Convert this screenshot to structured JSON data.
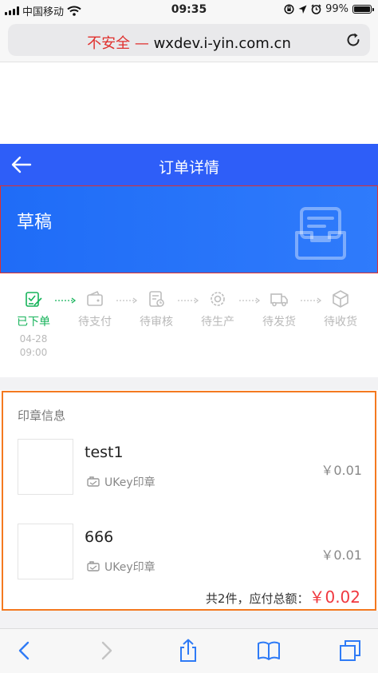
{
  "status_bar": {
    "carrier": "中国移动",
    "time": "09:35",
    "battery_percent": "99%",
    "battery_level": 0.99,
    "icons": [
      "signal-icon",
      "wifi-icon",
      "orientation-lock-icon",
      "location-icon",
      "alarm-icon",
      "battery-icon"
    ]
  },
  "browser": {
    "warning": "不安全 —",
    "host": "wxdev.i-yin.com.cn",
    "reload_icon": "reload-icon",
    "warning_color": "#e0302d"
  },
  "header": {
    "title": "订单详情",
    "back_icon": "back-arrow-icon",
    "color": "#2e5ef8"
  },
  "banner": {
    "status": "草稿",
    "icon": "inbox-draft-icon"
  },
  "steps": [
    {
      "label": "已下单",
      "date": "04-28",
      "time": "09:00",
      "active": true,
      "icon": "order-placed-icon"
    },
    {
      "label": "待支付",
      "active": false,
      "icon": "wallet-icon"
    },
    {
      "label": "待审核",
      "active": false,
      "icon": "review-icon"
    },
    {
      "label": "待生产",
      "active": false,
      "icon": "gear-icon"
    },
    {
      "label": "待发货",
      "active": false,
      "icon": "truck-icon"
    },
    {
      "label": "待收货",
      "active": false,
      "icon": "package-icon"
    }
  ],
  "seals": {
    "title": "印章信息",
    "items": [
      {
        "name": "test1",
        "type": "UKey印章",
        "price": "￥0.01"
      },
      {
        "name": "666",
        "type": "UKey印章",
        "price": "￥0.01"
      }
    ],
    "summary_prefix": "共2件，应付总额：",
    "total": "￥0.02",
    "total_color": "#f0383f"
  },
  "toolbar": {
    "icons": [
      "back-icon",
      "forward-icon",
      "share-icon",
      "bookmarks-icon",
      "tabs-icon"
    ]
  }
}
